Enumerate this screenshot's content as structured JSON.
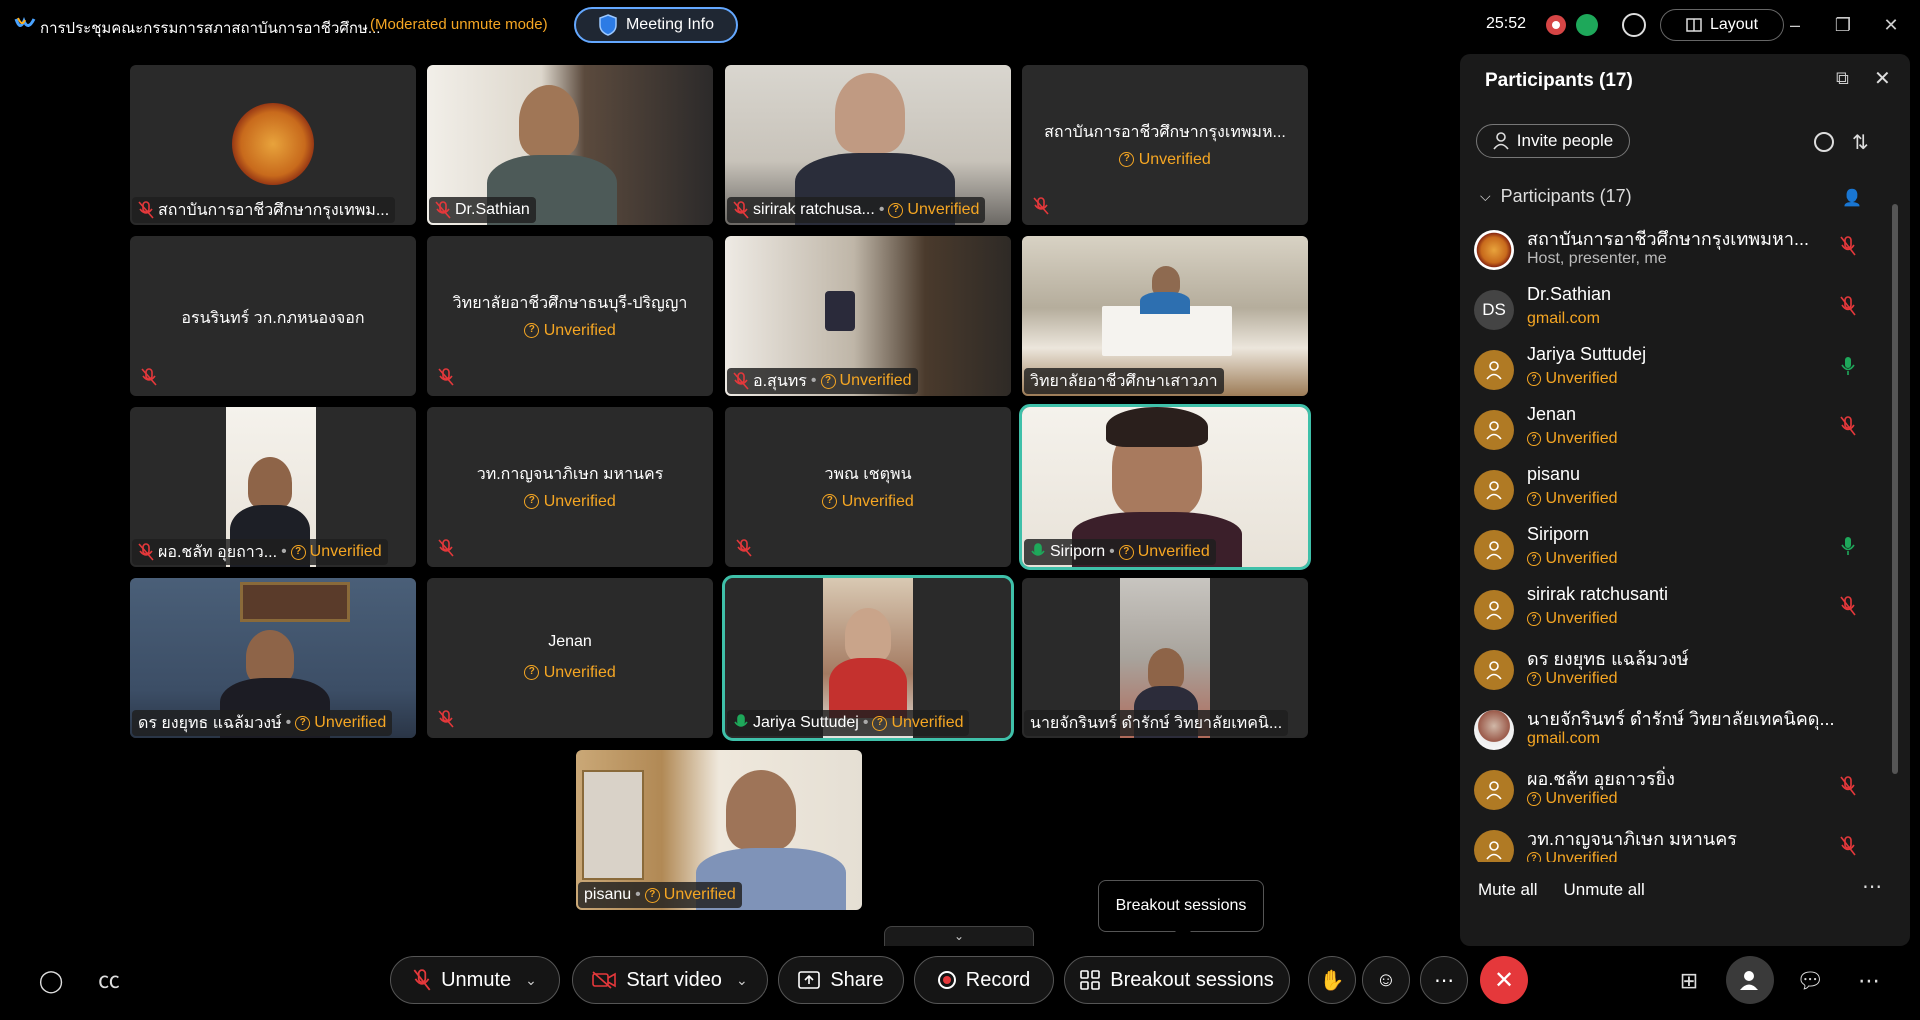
{
  "titlebar": {
    "meeting_title": "การประชุมคณะกรรมการสภาสถาบันการอาชีวศึกษ...",
    "moderated_label": "(Moderated unmute mode)",
    "meeting_info_label": "Meeting Info",
    "timer": "25:52",
    "layout_label": "Layout"
  },
  "tiles": [
    {
      "name": "สถาบันการอาชีวศึกษากรุงเทพม...",
      "unverified": ""
    },
    {
      "name": "Dr.Sathian",
      "unverified": ""
    },
    {
      "name": "sirirak ratchusa...",
      "unverified": "Unverified"
    },
    {
      "name": "สถาบันการอาชีวศึกษากรุงเทพมห...",
      "unverified": "Unverified"
    },
    {
      "name": "อรนรินทร์ วก.กภหนองจอก",
      "unverified": ""
    },
    {
      "name": "วิทยาลัยอาชีวศึกษาธนบุรี-ปริญญา",
      "unverified": "Unverified"
    },
    {
      "name": "อ.สุนทร",
      "unverified": "Unverified"
    },
    {
      "name": "วิทยาลัยอาชีวศึกษาเสาวภา",
      "unverified": ""
    },
    {
      "name": "ผอ.ชลัท อุยถาว...",
      "unverified": "Unverified"
    },
    {
      "name": "วท.กาญจนาภิเษก มหานคร",
      "unverified": "Unverified"
    },
    {
      "name": "วพณ เชตุพน",
      "unverified": "Unverified"
    },
    {
      "name": "Siriporn",
      "unverified": "Unverified"
    },
    {
      "name": "ดร ยงยุทธ แฉล้มวงษ์",
      "unverified": "Unverified"
    },
    {
      "name": "Jenan",
      "unverified": "Unverified"
    },
    {
      "name": "Jariya Suttudej",
      "unverified": "Unverified"
    },
    {
      "name": "นายจักรินทร์ ดำรักษ์ วิทยาลัยเทคนิ...",
      "unverified": ""
    },
    {
      "name": "pisanu",
      "unverified": "Unverified"
    }
  ],
  "panel": {
    "title": "Participants (17)",
    "invite_label": "Invite people",
    "section_label": "Participants (17)",
    "mute_all": "Mute all",
    "unmute_all": "Unmute all",
    "participants": [
      {
        "name": "สถาบันการอาชีวศึกษากรุงเทพมหา...",
        "sub": "Host, presenter, me",
        "avatar": "emblem",
        "mic": "muted"
      },
      {
        "name": "Dr.Sathian",
        "sub": "gmail.com",
        "avatar": "DS",
        "mic": "muted"
      },
      {
        "name": "Jariya Suttudej",
        "sub": "Unverified",
        "avatar": "guest",
        "mic": "on"
      },
      {
        "name": "Jenan",
        "sub": "Unverified",
        "avatar": "guest",
        "mic": "muted"
      },
      {
        "name": "pisanu",
        "sub": "Unverified",
        "avatar": "guest",
        "mic": "none"
      },
      {
        "name": "Siriporn",
        "sub": "Unverified",
        "avatar": "guest",
        "mic": "on"
      },
      {
        "name": "sirirak ratchusanti",
        "sub": "Unverified",
        "avatar": "guest",
        "mic": "muted"
      },
      {
        "name": "ดร ยงยุทธ แฉล้มวงษ์",
        "sub": "Unverified",
        "avatar": "guest",
        "mic": "none"
      },
      {
        "name": "นายจักรินทร์ ดำรักษ์ วิทยาลัยเทคนิคดุ...",
        "sub": "gmail.com",
        "avatar": "photo",
        "mic": "none"
      },
      {
        "name": "ผอ.ชลัท อุยถาวรยิ่ง",
        "sub": "Unverified",
        "avatar": "guest",
        "mic": "muted"
      },
      {
        "name": "วท.กาญจนาภิเษก มหานคร",
        "sub": "Unverified",
        "avatar": "guest",
        "mic": "muted"
      }
    ]
  },
  "tooltip": "Breakout sessions",
  "toolbar": {
    "unmute_label": "Unmute",
    "start_video_label": "Start video",
    "share_label": "Share",
    "record_label": "Record",
    "breakout_label": "Breakout sessions"
  },
  "colors": {
    "accent_unverified": "#f5a623",
    "active_speaker": "#3fc0a9",
    "muted_red": "#e5383b",
    "mic_on_green": "#1ea85a"
  }
}
